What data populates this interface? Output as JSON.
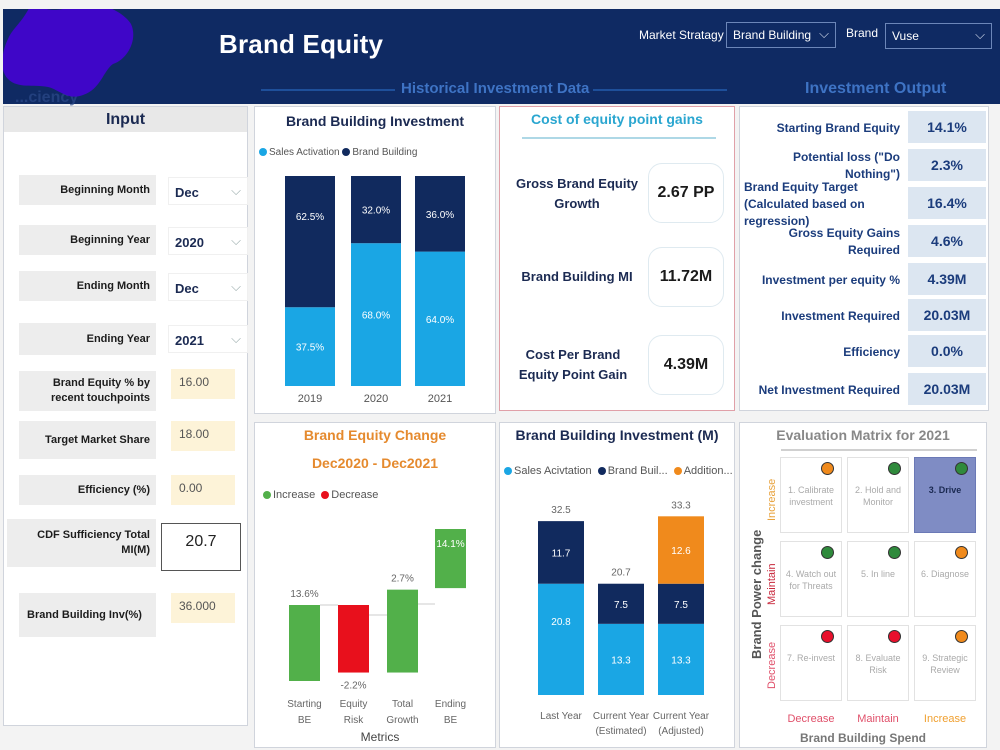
{
  "header": {
    "title": "Brand Equity",
    "partially_hidden_heading": "...ciency",
    "section_historical": "Historical Investment Data",
    "section_output": "Investment Output",
    "filters": {
      "market_strategy_label": "Market Stratagy",
      "market_strategy_value": "Brand Building",
      "brand_label": "Brand",
      "brand_value": "Vuse"
    }
  },
  "input": {
    "title": "Input",
    "dropdowns": [
      {
        "label": "Beginning Month",
        "value": "Dec"
      },
      {
        "label": "Beginning Year",
        "value": "2020"
      },
      {
        "label": "Ending Month",
        "value": "Dec"
      },
      {
        "label": "Ending Year",
        "value": "2021"
      }
    ],
    "fields": [
      {
        "label": "Brand Equity % by recent touchpoints",
        "value": "16.00"
      },
      {
        "label": "Target Market Share",
        "value": "18.00"
      },
      {
        "label": "Efficiency (%)",
        "value": "0.00"
      }
    ],
    "cdf": {
      "label": "CDF Sufficiency Total MI(M)",
      "value": "20.7"
    },
    "bb_inv": {
      "label": "Brand Building Inv(%)",
      "value": "36.000"
    }
  },
  "cost": {
    "title": "Cost of equity point gains",
    "rows": [
      {
        "label": "Gross Brand Equity Growth",
        "value": "2.67 PP"
      },
      {
        "label": "Brand Building MI",
        "value": "11.72M"
      },
      {
        "label": "Cost Per Brand Equity Point Gain",
        "value": "4.39M"
      }
    ]
  },
  "output": {
    "rows": [
      {
        "label": "Starting Brand Equity",
        "value": "14.1%"
      },
      {
        "label": "Potential loss (\"Do Nothing\")",
        "value": "2.3%"
      },
      {
        "label": "Brand Equity Target (Calculated based on regression)",
        "value": "16.4%"
      },
      {
        "label": "Gross Equity Gains Required",
        "value": "4.6%"
      },
      {
        "label": "Investment per equity %",
        "value": "4.39M"
      },
      {
        "label": "Investment Required",
        "value": "20.03M"
      },
      {
        "label": "Efficiency",
        "value": "0.0%"
      },
      {
        "label": "Net Investment Required",
        "value": "20.03M"
      }
    ]
  },
  "matrix": {
    "title": "Evaluation Matrix for 2021",
    "y_axis_title": "Brand Power change",
    "x_axis_title": "Brand Building Spend",
    "row_labels": [
      "Increase",
      "Maintain",
      "Decrease"
    ],
    "row_label_colors": [
      "#e8a23c",
      "#c8283c",
      "#e0506a"
    ],
    "col_labels": [
      "Decrease",
      "Maintain",
      "Increase"
    ],
    "col_label_colors": [
      "#e0506a",
      "#e0506a",
      "#f0a030"
    ],
    "cells": [
      {
        "text": "1. Calibrate investment",
        "status": "#f08a1c",
        "active": false
      },
      {
        "text": "2. Hold and Monitor",
        "status": "#2f8a3c",
        "active": false
      },
      {
        "text": "3. Drive",
        "status": "#2f8a3c",
        "active": true
      },
      {
        "text": "4. Watch out for Threats",
        "status": "#2f8a3c",
        "active": false
      },
      {
        "text": "5. In line",
        "status": "#2f8a3c",
        "active": false
      },
      {
        "text": "6. Diagnose",
        "status": "#f08a1c",
        "active": false
      },
      {
        "text": "7. Re-invest",
        "status": "#e8102c",
        "active": false
      },
      {
        "text": "8. Evaluate Risk",
        "status": "#e8102c",
        "active": false
      },
      {
        "text": "9. Strategic Review",
        "status": "#f08a1c",
        "active": false
      }
    ]
  },
  "chart_data": [
    {
      "id": "bbi_pct",
      "type": "bar",
      "stacked": true,
      "title": "Brand Building Investment",
      "categories": [
        "2019",
        "2020",
        "2021"
      ],
      "series": [
        {
          "name": "Sales Activation",
          "color": "#1aa6e4",
          "values": [
            37.5,
            68.0,
            64.0
          ]
        },
        {
          "name": "Brand Building",
          "color": "#112a5e",
          "values": [
            62.5,
            32.0,
            36.0
          ]
        }
      ],
      "value_format": "percent",
      "ylim": [
        0,
        100
      ],
      "legend": "top-left"
    },
    {
      "id": "waterfall",
      "type": "bar",
      "subtype": "waterfall",
      "title": "Brand Equity Change",
      "subtitle": "Dec2020 - Dec2021",
      "xlabel": "Metrics",
      "categories": [
        "Starting BE",
        "Equity Risk",
        "Total Growth",
        "Ending BE"
      ],
      "values": [
        13.6,
        -2.2,
        2.7,
        14.1
      ],
      "labels": [
        "13.6%",
        "-2.2%",
        "2.7%",
        "14.1%"
      ],
      "legend_entries": [
        {
          "name": "Increase",
          "color": "#52b04a"
        },
        {
          "name": "Decrease",
          "color": "#e8101c"
        }
      ],
      "legend": "top-left"
    },
    {
      "id": "bbi_m",
      "type": "bar",
      "stacked": true,
      "title": "Brand Building Investment (M)",
      "categories": [
        "Last Year",
        "Current Year (Estimated)",
        "Current Year (Adjusted)"
      ],
      "series": [
        {
          "name": "Sales Acivtation",
          "color": "#1aa6e4",
          "values": [
            20.8,
            13.3,
            13.3
          ]
        },
        {
          "name": "Brand Buil...",
          "color": "#112a5e",
          "values": [
            11.7,
            7.5,
            7.5
          ]
        },
        {
          "name": "Addition...",
          "color": "#f08a1c",
          "values": [
            0,
            0,
            12.6
          ]
        }
      ],
      "totals": [
        32.5,
        20.7,
        33.3
      ],
      "ylim": [
        0,
        35
      ],
      "legend": "top-left"
    }
  ]
}
